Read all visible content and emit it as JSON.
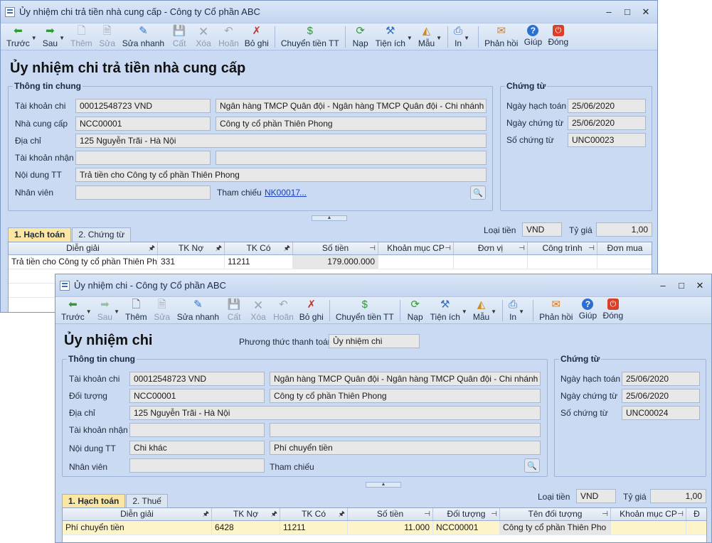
{
  "w1": {
    "title": "Ủy nhiệm chi trả tiền nhà cung cấp - Công ty Cổ phần ABC",
    "heading": "Ủy nhiệm chi trả tiền nhà cung cấp",
    "toolbar": [
      {
        "name": "prev",
        "label": "Trước",
        "icon": "back-arrow-icon",
        "dd": true
      },
      {
        "name": "next",
        "label": "Sau",
        "icon": "forward-arrow-icon",
        "dd": true
      },
      {
        "name": "add",
        "label": "Thêm",
        "icon": "new-doc-icon",
        "dis": true
      },
      {
        "name": "edit",
        "label": "Sửa",
        "icon": "edit-doc-icon",
        "dis": true
      },
      {
        "name": "quick-edit",
        "label": "Sửa nhanh",
        "icon": "pencil-icon"
      },
      {
        "name": "save",
        "label": "Cất",
        "icon": "floppy-icon",
        "dis": true
      },
      {
        "name": "delete",
        "label": "Xóa",
        "icon": "delete-icon",
        "dis": true
      },
      {
        "name": "undo",
        "label": "Hoãn",
        "icon": "undo-icon",
        "dis": true
      },
      {
        "name": "unpost",
        "label": "Bỏ ghi",
        "icon": "unpost-icon"
      },
      {
        "name": "transfer",
        "label": "Chuyển tiền TT",
        "icon": "money-transfer-icon",
        "sep": true
      },
      {
        "name": "reload",
        "label": "Nạp",
        "icon": "refresh-icon",
        "sep": true
      },
      {
        "name": "utilities",
        "label": "Tiện ích",
        "icon": "tools-icon",
        "dd": true
      },
      {
        "name": "template",
        "label": "Mẫu",
        "icon": "template-icon",
        "dd": true
      },
      {
        "name": "print",
        "label": "In",
        "icon": "print-icon",
        "dd": true,
        "sep": true
      },
      {
        "name": "feedback",
        "label": "Phản hồi",
        "icon": "envelope-icon",
        "sep": true
      },
      {
        "name": "help",
        "label": "Giúp",
        "icon": "help-icon"
      },
      {
        "name": "close",
        "label": "Đóng",
        "icon": "close-icon"
      }
    ],
    "general": {
      "title": "Thông tin chung",
      "account_label": "Tài khoản chi",
      "account": "00012548723 VND",
      "bank": "Ngân hàng TMCP Quân đội  - Ngân hàng TMCP Quân đội - Chi nhánh Th",
      "supplier_label": "Nhà cung cấp",
      "supplier_code": "NCC00001",
      "supplier_name": "Công ty cổ phần Thiên Phong",
      "address_label": "Địa chỉ",
      "address": "125 Nguyễn Trãi - Hà Nội",
      "recv_label": "Tài khoản nhận",
      "recv": "",
      "recv_bank": "",
      "content_label": "Nội dung TT",
      "content": "Trả tiền cho Công ty cổ phần Thiên Phong",
      "staff_label": "Nhân viên",
      "staff": "",
      "ref_label": "Tham chiếu",
      "ref_link": "NK00017",
      "ref_more": "..."
    },
    "voucher": {
      "title": "Chứng từ",
      "post_date_label": "Ngày hạch toán",
      "post_date": "25/06/2020",
      "voucher_date_label": "Ngày chứng từ",
      "voucher_date": "25/06/2020",
      "voucher_no_label": "Số chứng từ",
      "voucher_no": "UNC00023"
    },
    "tabs": [
      {
        "label": "1. Hạch toán"
      },
      {
        "label": "2. Chứng từ"
      }
    ],
    "currency_label": "Loại tiền",
    "currency": "VND",
    "rate_label": "Tỷ giá",
    "rate": "1,00",
    "grid_headers": [
      "Diễn giải",
      "TK Nợ",
      "TK Có",
      "Số tiền",
      "Khoản mục CP",
      "Đơn vị",
      "Công trình",
      "Đơn mua"
    ],
    "grid_rows": [
      [
        "Trả tiền cho Công ty cổ phần Thiên Pho",
        "331",
        "11211",
        "179.000.000",
        "",
        "",
        "",
        ""
      ]
    ]
  },
  "w2": {
    "title": "Ủy nhiệm chi - Công ty Cổ phần ABC",
    "heading": "Ủy nhiệm chi",
    "method_label": "Phương thức thanh toán",
    "method": "Ủy nhiệm chi",
    "toolbar": [
      {
        "name": "prev",
        "label": "Trước",
        "icon": "back-arrow-icon",
        "dd": true
      },
      {
        "name": "next",
        "label": "Sau",
        "icon": "forward-arrow-icon",
        "dd": true,
        "dis": true
      },
      {
        "name": "add",
        "label": "Thêm",
        "icon": "new-doc-icon"
      },
      {
        "name": "edit",
        "label": "Sửa",
        "icon": "edit-doc-icon",
        "dis": true
      },
      {
        "name": "quick-edit",
        "label": "Sửa nhanh",
        "icon": "pencil-icon"
      },
      {
        "name": "save",
        "label": "Cất",
        "icon": "floppy-icon",
        "dis": true
      },
      {
        "name": "delete",
        "label": "Xóa",
        "icon": "delete-icon",
        "dis": true
      },
      {
        "name": "undo",
        "label": "Hoãn",
        "icon": "undo-icon",
        "dis": true
      },
      {
        "name": "unpost",
        "label": "Bỏ ghi",
        "icon": "unpost-icon"
      },
      {
        "name": "transfer",
        "label": "Chuyển tiền TT",
        "icon": "money-transfer-icon",
        "sep": true
      },
      {
        "name": "reload",
        "label": "Nạp",
        "icon": "refresh-icon",
        "sep": true
      },
      {
        "name": "utilities",
        "label": "Tiện ích",
        "icon": "tools-icon",
        "dd": true
      },
      {
        "name": "template",
        "label": "Mẫu",
        "icon": "template-icon",
        "dd": true
      },
      {
        "name": "print",
        "label": "In",
        "icon": "print-icon",
        "dd": true,
        "sep": true
      },
      {
        "name": "feedback",
        "label": "Phản hồi",
        "icon": "envelope-icon",
        "sep": true
      },
      {
        "name": "help",
        "label": "Giúp",
        "icon": "help-icon"
      },
      {
        "name": "close",
        "label": "Đóng",
        "icon": "close-icon"
      }
    ],
    "general": {
      "title": "Thông tin chung",
      "account_label": "Tài khoản chi",
      "account": "00012548723 VND",
      "bank": "Ngân hàng TMCP Quân đội  - Ngân hàng TMCP Quân đội - Chi nhánh Th",
      "object_label": "Đối tượng",
      "object_code": "NCC00001",
      "object_name": "Công ty cổ phần Thiên Phong",
      "address_label": "Địa chỉ",
      "address": "125 Nguyễn Trãi - Hà Nội",
      "recv_label": "Tài khoản nhận",
      "recv": "",
      "recv_bank": "",
      "content_label": "Nội dung TT",
      "content": "Chi khác",
      "content2": "Phí chuyển tiền",
      "staff_label": "Nhân viên",
      "staff": "",
      "ref_label": "Tham chiếu"
    },
    "voucher": {
      "title": "Chứng từ",
      "post_date_label": "Ngày hạch toán",
      "post_date": "25/06/2020",
      "voucher_date_label": "Ngày chứng từ",
      "voucher_date": "25/06/2020",
      "voucher_no_label": "Số chứng từ",
      "voucher_no": "UNC00024"
    },
    "tabs": [
      {
        "label": "1. Hạch toán"
      },
      {
        "label": "2. Thuế"
      }
    ],
    "currency_label": "Loại tiền",
    "currency": "VND",
    "rate_label": "Tỷ giá",
    "rate": "1,00",
    "grid_headers": [
      "Diễn giải",
      "TK Nợ",
      "TK Có",
      "Số tiền",
      "Đối tượng",
      "Tên đối tượng",
      "Khoản mục CP",
      "Đ"
    ],
    "grid_rows": [
      [
        "Phí chuyển tiền",
        "6428",
        "11211",
        "11.000",
        "NCC00001",
        "Công ty cổ phần Thiên Pho",
        "",
        ""
      ]
    ]
  },
  "colors": {
    "window_bg": "#c9daf2",
    "active_tab": "#fbe6a3",
    "link": "#1a3fc4"
  }
}
